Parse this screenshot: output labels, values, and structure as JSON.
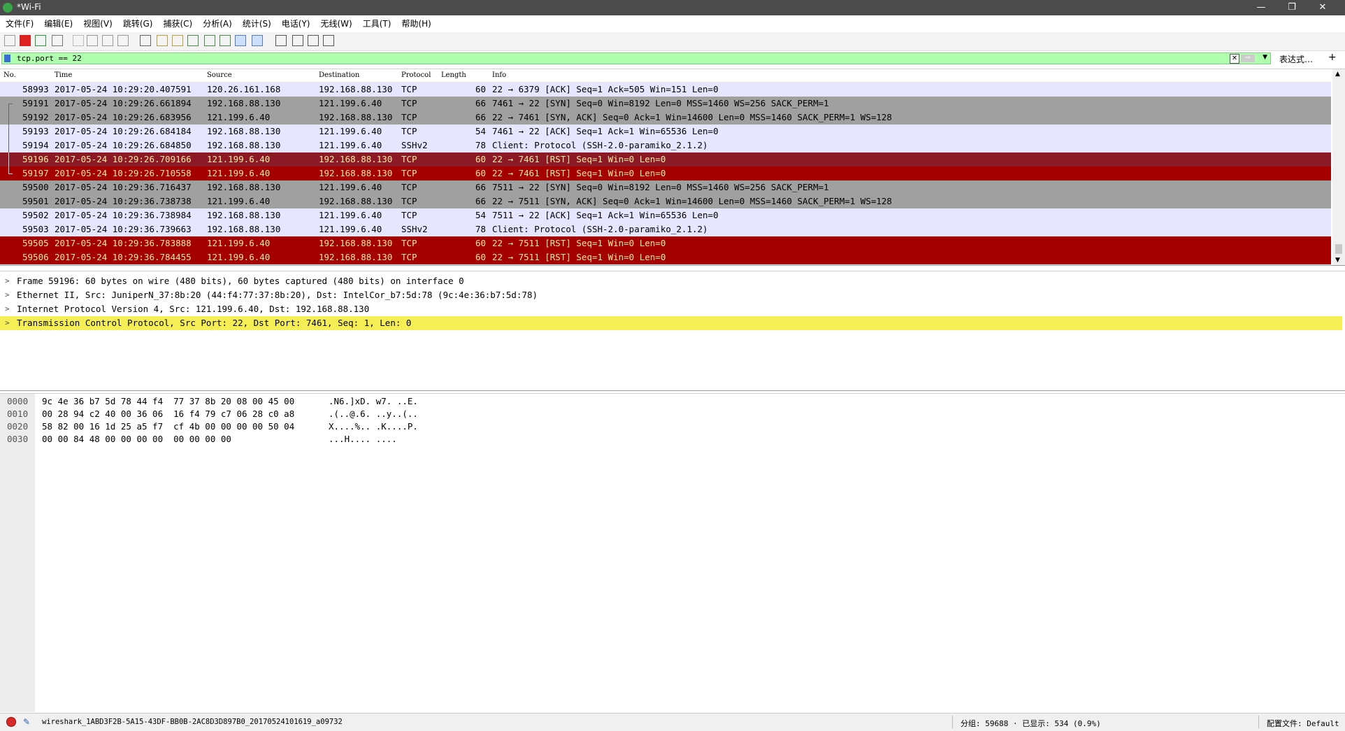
{
  "window": {
    "title": "*Wi-Fi",
    "minimize": "—",
    "restore": "❐",
    "close": "✕"
  },
  "menu": [
    "文件(F)",
    "编辑(E)",
    "视图(V)",
    "跳转(G)",
    "捕获(C)",
    "分析(A)",
    "统计(S)",
    "电话(Y)",
    "无线(W)",
    "工具(T)",
    "帮助(H)"
  ],
  "toolbar_icons": [
    "shark-fin-start-icon",
    "stop-capture-icon",
    "restart-capture-icon",
    "capture-options-icon",
    "open-file-icon",
    "save-file-icon",
    "close-file-icon",
    "reload-file-icon",
    "find-packet-icon",
    "go-back-icon",
    "go-forward-icon",
    "go-to-packet-icon",
    "first-packet-icon",
    "last-packet-icon",
    "autoscroll-icon",
    "colorize-icon",
    "zoom-in-icon",
    "zoom-out-icon",
    "normal-size-icon",
    "resize-columns-icon"
  ],
  "filter": {
    "value": "tcp.port == 22",
    "expression_label": "表达式…",
    "add_label": "+"
  },
  "columns": [
    "No.",
    "Time",
    "Source",
    "Destination",
    "Protocol",
    "Length",
    "Info"
  ],
  "colors": {
    "light": "#e7e6ff",
    "gray": "#a0a0a0",
    "darkred": "#8b1a26",
    "red": "#a40000"
  },
  "packets": [
    {
      "no": "58993",
      "time": "2017-05-24 10:29:20.407591",
      "src": "120.26.161.168",
      "dst": "192.168.88.130",
      "proto": "TCP",
      "len": "60",
      "info": "22 → 6379 [ACK] Seq=1 Ack=505 Win=151 Len=0",
      "style": "light",
      "conv": ""
    },
    {
      "no": "59191",
      "time": "2017-05-24 10:29:26.661894",
      "src": "192.168.88.130",
      "dst": "121.199.6.40",
      "proto": "TCP",
      "len": "66",
      "info": "7461 → 22 [SYN] Seq=0 Win=8192 Len=0 MSS=1460 WS=256 SACK_PERM=1",
      "style": "gray",
      "conv": "start"
    },
    {
      "no": "59192",
      "time": "2017-05-24 10:29:26.683956",
      "src": "121.199.6.40",
      "dst": "192.168.88.130",
      "proto": "TCP",
      "len": "66",
      "info": "22 → 7461 [SYN, ACK] Seq=0 Ack=1 Win=14600 Len=0 MSS=1460 SACK_PERM=1 WS=128",
      "style": "gray",
      "conv": "mid"
    },
    {
      "no": "59193",
      "time": "2017-05-24 10:29:26.684184",
      "src": "192.168.88.130",
      "dst": "121.199.6.40",
      "proto": "TCP",
      "len": "54",
      "info": "7461 → 22 [ACK] Seq=1 Ack=1 Win=65536 Len=0",
      "style": "light",
      "conv": "mid"
    },
    {
      "no": "59194",
      "time": "2017-05-24 10:29:26.684850",
      "src": "192.168.88.130",
      "dst": "121.199.6.40",
      "proto": "SSHv2",
      "len": "78",
      "info": "Client: Protocol (SSH-2.0-paramiko_2.1.2)",
      "style": "light",
      "conv": "mid"
    },
    {
      "no": "59196",
      "time": "2017-05-24 10:29:26.709166",
      "src": "121.199.6.40",
      "dst": "192.168.88.130",
      "proto": "TCP",
      "len": "60",
      "info": "22 → 7461 [RST] Seq=1 Win=0 Len=0",
      "style": "darkred",
      "conv": "mid"
    },
    {
      "no": "59197",
      "time": "2017-05-24 10:29:26.710558",
      "src": "121.199.6.40",
      "dst": "192.168.88.130",
      "proto": "TCP",
      "len": "60",
      "info": "22 → 7461 [RST] Seq=1 Win=0 Len=0",
      "style": "red",
      "conv": "end"
    },
    {
      "no": "59500",
      "time": "2017-05-24 10:29:36.716437",
      "src": "192.168.88.130",
      "dst": "121.199.6.40",
      "proto": "TCP",
      "len": "66",
      "info": "7511 → 22 [SYN] Seq=0 Win=8192 Len=0 MSS=1460 WS=256 SACK_PERM=1",
      "style": "gray",
      "conv": ""
    },
    {
      "no": "59501",
      "time": "2017-05-24 10:29:36.738738",
      "src": "121.199.6.40",
      "dst": "192.168.88.130",
      "proto": "TCP",
      "len": "66",
      "info": "22 → 7511 [SYN, ACK] Seq=0 Ack=1 Win=14600 Len=0 MSS=1460 SACK_PERM=1 WS=128",
      "style": "gray",
      "conv": ""
    },
    {
      "no": "59502",
      "time": "2017-05-24 10:29:36.738984",
      "src": "192.168.88.130",
      "dst": "121.199.6.40",
      "proto": "TCP",
      "len": "54",
      "info": "7511 → 22 [ACK] Seq=1 Ack=1 Win=65536 Len=0",
      "style": "light",
      "conv": ""
    },
    {
      "no": "59503",
      "time": "2017-05-24 10:29:36.739663",
      "src": "192.168.88.130",
      "dst": "121.199.6.40",
      "proto": "SSHv2",
      "len": "78",
      "info": "Client: Protocol (SSH-2.0-paramiko_2.1.2)",
      "style": "light",
      "conv": ""
    },
    {
      "no": "59505",
      "time": "2017-05-24 10:29:36.783888",
      "src": "121.199.6.40",
      "dst": "192.168.88.130",
      "proto": "TCP",
      "len": "60",
      "info": "22 → 7511 [RST] Seq=1 Win=0 Len=0",
      "style": "red",
      "conv": ""
    },
    {
      "no": "59506",
      "time": "2017-05-24 10:29:36.784455",
      "src": "121.199.6.40",
      "dst": "192.168.88.130",
      "proto": "TCP",
      "len": "60",
      "info": "22 → 7511 [RST] Seq=1 Win=0 Len=0",
      "style": "red",
      "conv": ""
    }
  ],
  "details": [
    {
      "text": "Frame 59196: 60 bytes on wire (480 bits), 60 bytes captured (480 bits) on interface 0",
      "selected": false
    },
    {
      "text": "Ethernet II, Src: JuniperN_37:8b:20 (44:f4:77:37:8b:20), Dst: IntelCor_b7:5d:78 (9c:4e:36:b7:5d:78)",
      "selected": false
    },
    {
      "text": "Internet Protocol Version 4, Src: 121.199.6.40, Dst: 192.168.88.130",
      "selected": false
    },
    {
      "text": "Transmission Control Protocol, Src Port: 22, Dst Port: 7461, Seq: 1, Len: 0",
      "selected": true
    }
  ],
  "detail_arrow": ">",
  "highlight_color": "#f5ee55",
  "bytes": [
    {
      "offset": "0000",
      "hex": "9c 4e 36 b7 5d 78 44 f4  77 37 8b 20 08 00 45 00",
      "ascii": ".N6.]xD. w7. ..E."
    },
    {
      "offset": "0010",
      "hex": "00 28 94 c2 40 00 36 06  16 f4 79 c7 06 28 c0 a8",
      "ascii": ".(..@.6. ..y..(.."
    },
    {
      "offset": "0020",
      "hex": "58 82 00 16 1d 25 a5 f7  cf 4b 00 00 00 00 50 04",
      "ascii": "X....%.. .K....P."
    },
    {
      "offset": "0030",
      "hex": "00 00 84 48 00 00 00 00  00 00 00 00",
      "ascii": "...H.... ...."
    }
  ],
  "status": {
    "file": "wireshark_1ABD3F2B-5A15-43DF-BB0B-2AC8D3D897B0_20170524101619_a09732",
    "packets": "分组: 59688 · 已显示: 534 (0.9%)",
    "profile": "配置文件: Default"
  }
}
